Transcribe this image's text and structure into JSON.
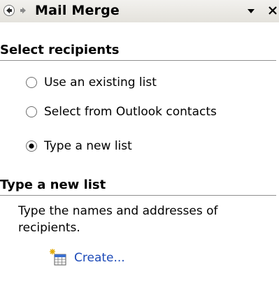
{
  "pane": {
    "title": "Mail Merge",
    "nav_back_icon": "back-arrow-icon",
    "nav_forward_icon": "forward-arrow-icon",
    "menu_icon": "dropdown-triangle-icon",
    "close_icon": "close-icon"
  },
  "select_recipients": {
    "header": "Select recipients",
    "options": [
      {
        "label": "Use an existing list",
        "selected": false
      },
      {
        "label": "Select from Outlook contacts",
        "selected": false
      },
      {
        "label": "Type a new list",
        "selected": true
      }
    ]
  },
  "type_new_list": {
    "header": "Type a new list",
    "description": "Type the names and addresses of recipients.",
    "create_label": "Create...",
    "create_icon": "new-table-sparkle-icon"
  },
  "colors": {
    "link": "#1c4ab8",
    "rule": "#8f8f8f",
    "titlebar": "#e4e2dc"
  }
}
